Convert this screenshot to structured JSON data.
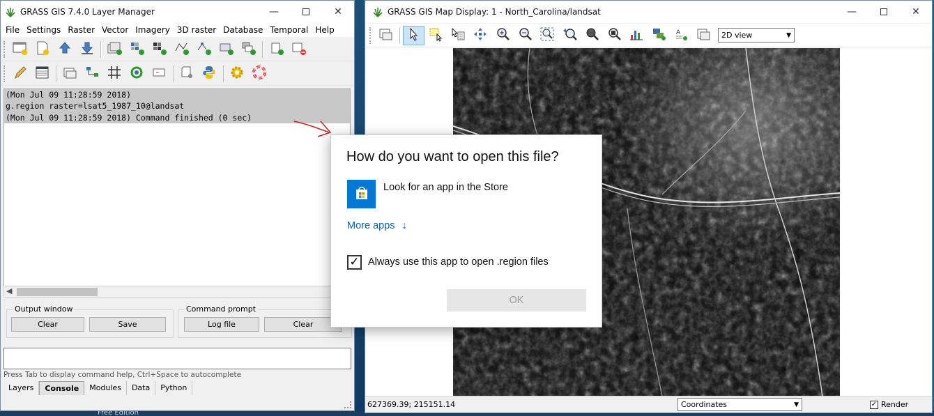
{
  "layer_manager": {
    "title": "GRASS GIS 7.4.0 Layer Manager",
    "menu": [
      "File",
      "Settings",
      "Raster",
      "Vector",
      "Imagery",
      "3D raster",
      "Database",
      "Temporal",
      "Help"
    ],
    "console_lines": [
      "(Mon Jul 09 11:28:59 2018)",
      "g.region raster=lsat5_1987_10@landsat",
      "(Mon Jul 09 11:28:59 2018) Command finished (0 sec)"
    ],
    "output_window": {
      "label": "Output window",
      "clear": "Clear",
      "save": "Save"
    },
    "command_prompt": {
      "label": "Command prompt",
      "log_file": "Log file",
      "clear": "Clear"
    },
    "hint": "Press Tab to display command help, Ctrl+Space to autocomplete",
    "tabs": [
      "Layers",
      "Console",
      "Modules",
      "Data",
      "Python"
    ],
    "active_tab": "Console"
  },
  "map_display": {
    "title": "GRASS GIS Map Display: 1 - North_Carolina/landsat",
    "view_mode": "2D view",
    "coordinates": "627369.39; 215151.14",
    "status_mode": "Coordinates",
    "render_label": "Render"
  },
  "dialog": {
    "question": "How do you want to open this file?",
    "store_option": "Look for an app in the Store",
    "more_apps": "More apps",
    "always_use": "Always use this app to open .region files",
    "ok": "OK"
  },
  "background": {
    "text": "Free Edition"
  },
  "colors": {
    "accent": "#0078d7",
    "link": "#0063b1",
    "annotation_arrow": "#d02020"
  }
}
